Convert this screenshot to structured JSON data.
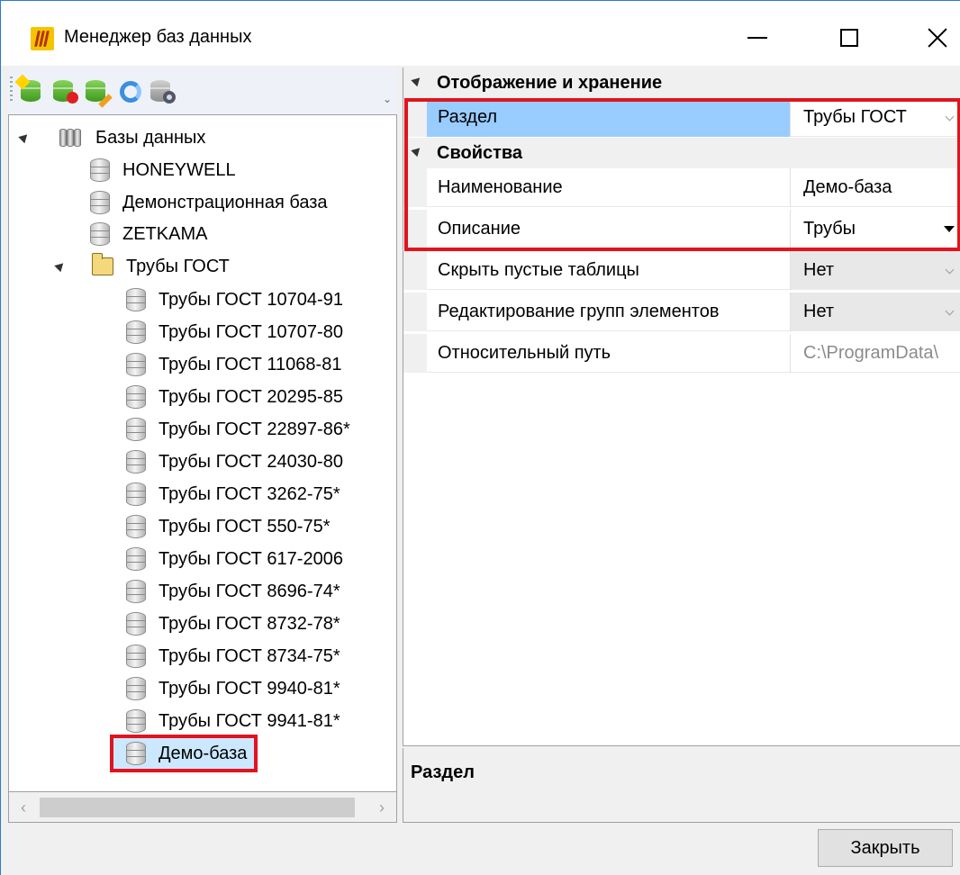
{
  "window": {
    "title": "Менеджер баз данных",
    "controls": [
      "minimize",
      "maximize",
      "close"
    ]
  },
  "toolbar": {
    "icons": [
      "add-database-icon",
      "remove-database-icon",
      "edit-database-icon",
      "refresh-icon",
      "database-settings-icon"
    ]
  },
  "tree": {
    "root": "Базы данных",
    "items": [
      {
        "label": "HONEYWELL"
      },
      {
        "label": "Демонстрационная база"
      },
      {
        "label": "ZETKAMA"
      }
    ],
    "folder": {
      "label": "Трубы ГОСТ",
      "children": [
        "Трубы ГОСТ 10704-91",
        "Трубы ГОСТ 10707-80",
        "Трубы ГОСТ 11068-81",
        "Трубы ГОСТ 20295-85",
        "Трубы ГОСТ 22897-86*",
        "Трубы ГОСТ 24030-80",
        "Трубы ГОСТ 3262-75*",
        "Трубы ГОСТ 550-75*",
        "Трубы ГОСТ 617-2006",
        "Трубы ГОСТ 8696-74*",
        "Трубы ГОСТ 8732-78*",
        "Трубы ГОСТ 8734-75*",
        "Трубы ГОСТ 9940-81*",
        "Трубы ГОСТ 9941-81*"
      ],
      "selected": "Демо-база"
    }
  },
  "properties": {
    "category1": "Отображение и хранение",
    "category2": "Свойства",
    "rows": [
      {
        "name": "Раздел",
        "value": "Трубы ГОСТ"
      },
      {
        "name": "Наименование",
        "value": "Демо-база"
      },
      {
        "name": "Описание",
        "value": "Трубы"
      },
      {
        "name": "Скрыть пустые таблицы",
        "value": "Нет"
      },
      {
        "name": "Редактирование групп элементов",
        "value": "Нет"
      },
      {
        "name": "Относительный путь",
        "value": "C:\\ProgramData\\"
      }
    ]
  },
  "description": {
    "title": "Раздел"
  },
  "buttons": {
    "close": "Закрыть"
  },
  "colors": {
    "selection": "#99ccff",
    "tree_selection": "#cce8ff",
    "highlight": "#e0141e",
    "window_border": "#2b79d0"
  }
}
